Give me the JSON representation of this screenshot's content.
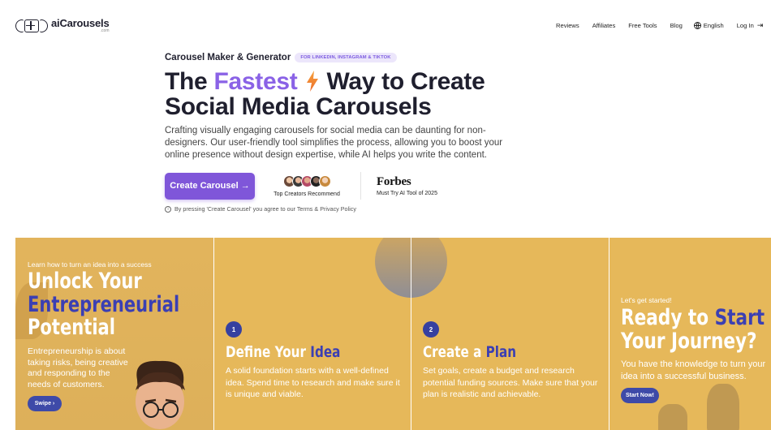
{
  "header": {
    "logo_name": "aiCarousels",
    "logo_sub": ".com",
    "nav": {
      "reviews": "Reviews",
      "affiliates": "Affiliates",
      "free_tools": "Free Tools",
      "blog": "Blog",
      "language": "English",
      "login": "Log In"
    }
  },
  "hero": {
    "eyebrow": "Carousel Maker & Generator",
    "pill": "FOR LINKEDIN, INSTAGRAM & TIKTOK",
    "title_part1": "The ",
    "title_accent": "Fastest",
    "title_part2": "Way to Create",
    "title_line2": "Social Media Carousels",
    "description": "Crafting visually engaging carousels for social media can be daunting for non-designers. Our user-friendly tool simplifies the process, allowing you to boost your online presence without design expertise, while AI helps you write the content.",
    "cta": "Create Carousel →",
    "creators_caption": "Top Creators Recommend",
    "forbes_logo": "Forbes",
    "forbes_caption": "Must Try AI Tool of 2025",
    "terms": "By pressing 'Create Carousel' you agree to our Terms & Privacy Policy"
  },
  "colors": {
    "accent": "#7f56d9",
    "carousel_bg": "#e6b85a",
    "slide_highlight": "#3b3fb3"
  },
  "slides": [
    {
      "lead": "Learn how to turn an idea into a success",
      "title_l1": "Unlock Your",
      "title_l2": "Entrepreneurial",
      "title_l3": "Potential",
      "body": "Entrepreneurship is about taking risks, being creative and responding to the needs of customers.",
      "button": "Swipe ›"
    },
    {
      "number": "1",
      "title_a": "Define Your ",
      "title_b": "Idea",
      "body": "A solid foundation starts with a well-defined idea. Spend time to research and make sure it is unique and viable."
    },
    {
      "number": "2",
      "title_a": "Create a ",
      "title_b": "Plan",
      "body": "Set goals, create a budget and research potential funding sources. Make sure that your plan is realistic and achievable."
    },
    {
      "lead": "Let's get started!",
      "title_a": "Ready to ",
      "title_b": "Start",
      "title_l2": "Your Journey?",
      "body": "You have the knowledge to turn your idea into a successful business.",
      "button": "Start Now!"
    }
  ],
  "icons": [
    "logo-icon",
    "globe-icon",
    "login-icon",
    "lightning-icon",
    "info-icon",
    "chevron-right-icon"
  ]
}
